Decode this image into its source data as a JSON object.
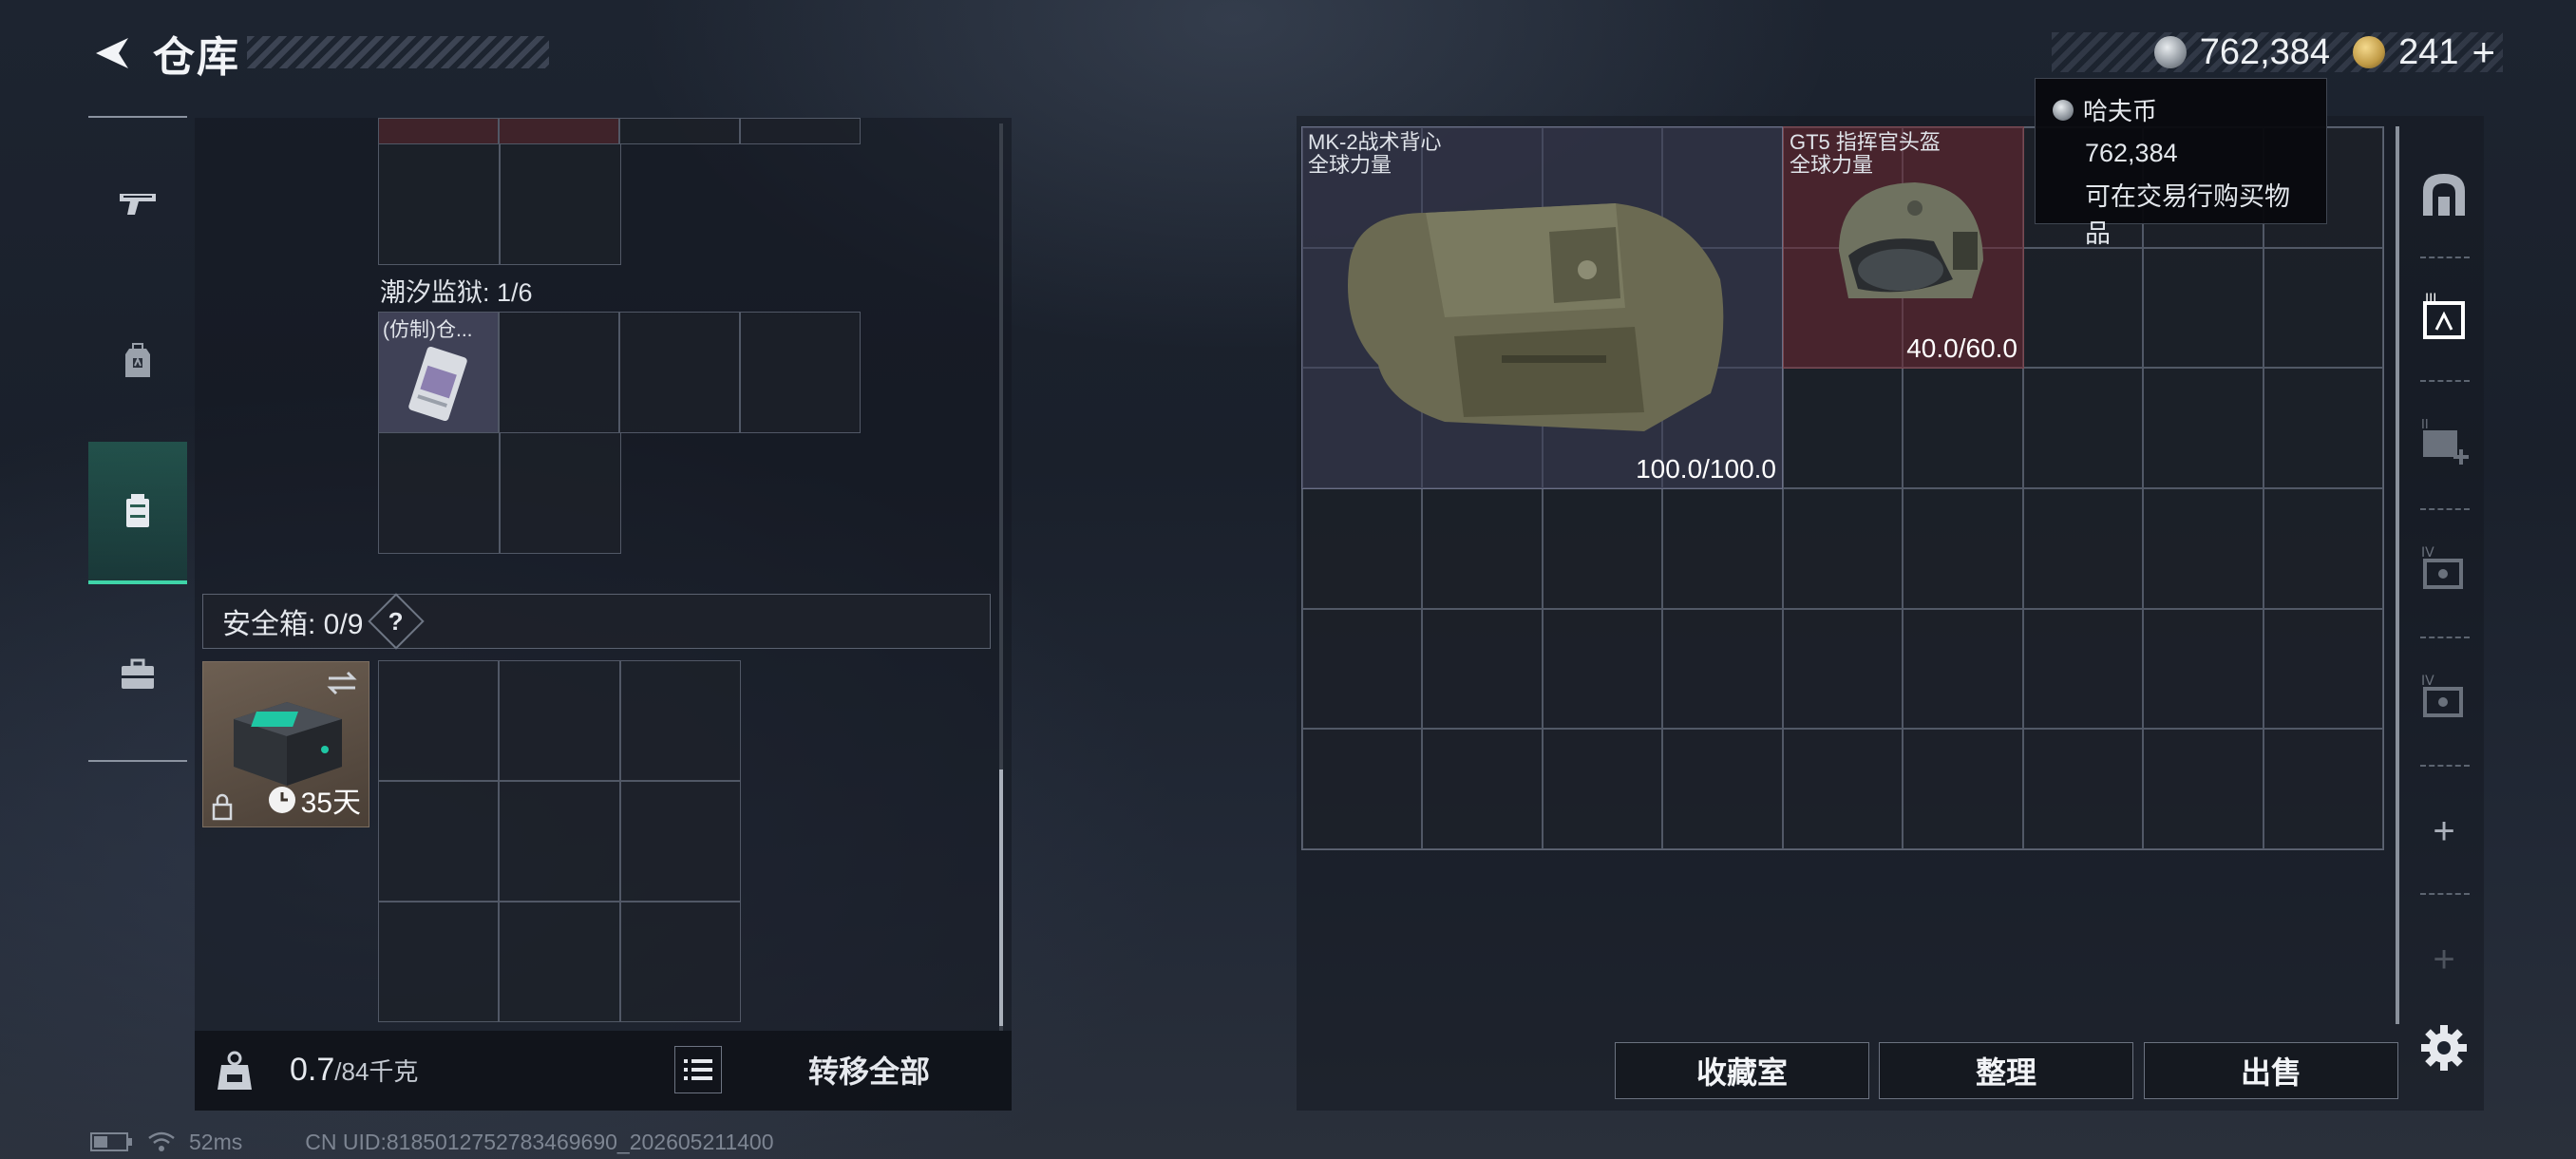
{
  "header": {
    "title": "仓库"
  },
  "currency": {
    "silver_value": "762,384",
    "gold_value": "241",
    "plus": "+"
  },
  "tooltip": {
    "title": "哈夫币",
    "amount": "762,384",
    "desc": "可在交易行购买物品"
  },
  "left_panel": {
    "container_label": "潮汐监狱: 1/6",
    "container_item": "(仿制)仓...",
    "safe_box_label": "安全箱: 0/9",
    "help": "?",
    "safe_item_days": "35天",
    "weight_current": "0.7",
    "weight_max": "/84千克",
    "transfer_all": "转移全部"
  },
  "stash": {
    "items": [
      {
        "name": "MK-2战术背心",
        "subtitle": "全球力量",
        "durability": "100.0/100.0"
      },
      {
        "name": "GT5 指挥官头盔",
        "subtitle": "全球力量",
        "durability": "40.0/60.0"
      }
    ]
  },
  "actions": {
    "collection": "收藏室",
    "sort": "整理",
    "sell": "出售"
  },
  "right_tools": {
    "add": "+",
    "add_disabled": "+"
  },
  "footer": {
    "ping": "52ms",
    "uid": "CN UID:8185012752783469690_202605211400"
  },
  "colors": {
    "accent": "#3fd4a8",
    "vest_bg": "#2e3142",
    "helmet_bg": "#5a2a30"
  }
}
